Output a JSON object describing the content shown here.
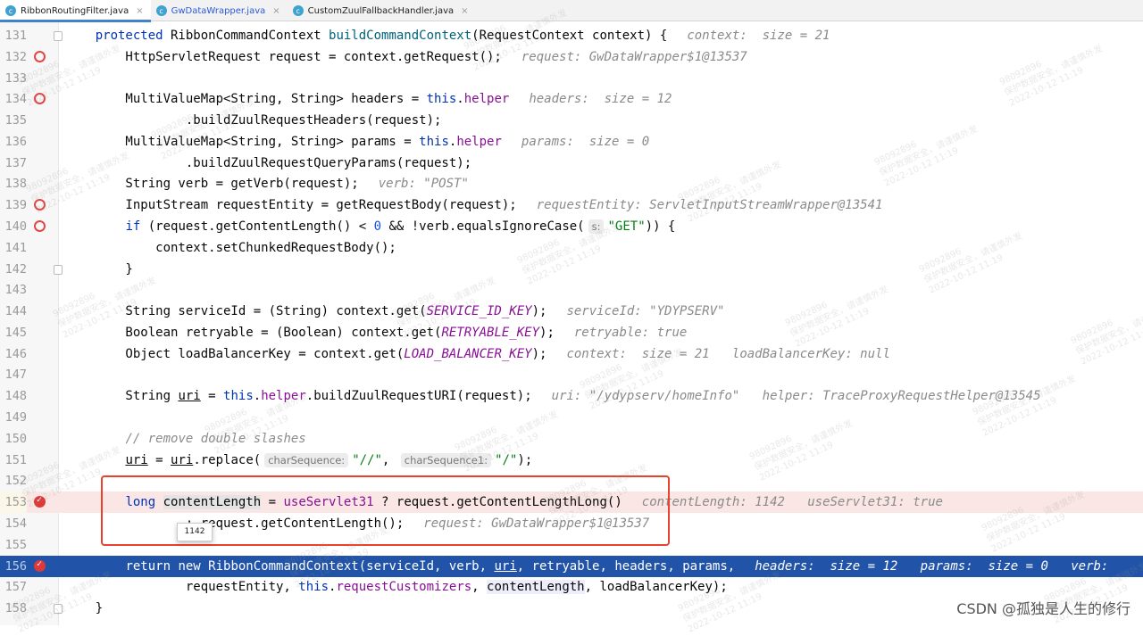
{
  "tabs": [
    {
      "label": "RibbonRoutingFilter.java",
      "active": true,
      "icon": "java-class-icon"
    },
    {
      "label": "GwDataWrapper.java",
      "modified": true,
      "icon": "java-class-icon"
    },
    {
      "label": "CustomZuulFallbackHandler.java",
      "icon": "java-class-icon"
    }
  ],
  "colors": {
    "breakpoint": "#dc3a3a",
    "execution_line": "#2154a8",
    "annotation_box": "#e8412e"
  },
  "editor": {
    "lines": [
      {
        "n": "131",
        "fold": true,
        "tokens": [
          {
            "c": "",
            "t": "    "
          },
          {
            "c": "kw",
            "t": "protected"
          },
          {
            "c": "",
            "t": " RibbonCommandContext "
          },
          {
            "c": "fn",
            "t": "buildCommandContext"
          },
          {
            "c": "",
            "t": "(RequestContext context) {"
          },
          {
            "c": "hint",
            "t": "context:  size = 21"
          }
        ]
      },
      {
        "n": "132",
        "bp": "hollow",
        "tokens": [
          {
            "c": "",
            "t": "        HttpServletRequest request = context.getRequest();"
          },
          {
            "c": "hint",
            "t": "request: GwDataWrapper$1@13537"
          }
        ]
      },
      {
        "n": "133",
        "tokens": []
      },
      {
        "n": "134",
        "bp": "hollow",
        "tokens": [
          {
            "c": "",
            "t": "        MultiValueMap<String, String> headers = "
          },
          {
            "c": "kw",
            "t": "this"
          },
          {
            "c": "",
            "t": "."
          },
          {
            "c": "fld",
            "t": "helper"
          },
          {
            "c": "hint",
            "t": "headers:  size = 12"
          }
        ]
      },
      {
        "n": "135",
        "tokens": [
          {
            "c": "",
            "t": "                .buildZuulRequestHeaders(request);"
          }
        ]
      },
      {
        "n": "136",
        "tokens": [
          {
            "c": "",
            "t": "        MultiValueMap<String, String> params = "
          },
          {
            "c": "kw",
            "t": "this"
          },
          {
            "c": "",
            "t": "."
          },
          {
            "c": "fld",
            "t": "helper"
          },
          {
            "c": "hint",
            "t": "params:  size = 0"
          }
        ]
      },
      {
        "n": "137",
        "tokens": [
          {
            "c": "",
            "t": "                .buildZuulRequestQueryParams(request);"
          }
        ]
      },
      {
        "n": "138",
        "tokens": [
          {
            "c": "",
            "t": "        String verb = getVerb(request);"
          },
          {
            "c": "hint",
            "t": "verb: \"POST\""
          }
        ]
      },
      {
        "n": "139",
        "bp": "hollow",
        "tokens": [
          {
            "c": "",
            "t": "        InputStream requestEntity = getRequestBody(request);"
          },
          {
            "c": "hint",
            "t": "requestEntity: ServletInputStreamWrapper@13541"
          }
        ]
      },
      {
        "n": "140",
        "bp": "hollow",
        "tokens": [
          {
            "c": "",
            "t": "        "
          },
          {
            "c": "kw",
            "t": "if"
          },
          {
            "c": "",
            "t": " (request.getContentLength() < "
          },
          {
            "c": "num",
            "t": "0"
          },
          {
            "c": "",
            "t": " && !verb.equalsIgnoreCase("
          },
          {
            "c": "ph",
            "t": "s:"
          },
          {
            "c": "str",
            "t": "\"GET\""
          },
          {
            "c": "",
            "t": ")) {"
          }
        ]
      },
      {
        "n": "141",
        "tokens": [
          {
            "c": "",
            "t": "            context.setChunkedRequestBody();"
          }
        ]
      },
      {
        "n": "142",
        "fold": true,
        "tokens": [
          {
            "c": "",
            "t": "        }"
          }
        ]
      },
      {
        "n": "143",
        "tokens": []
      },
      {
        "n": "144",
        "tokens": [
          {
            "c": "",
            "t": "        String serviceId = (String) context.get("
          },
          {
            "c": "cst",
            "t": "SERVICE_ID_KEY"
          },
          {
            "c": "",
            "t": ");"
          },
          {
            "c": "hint",
            "t": "serviceId: \"YDYPSERV\""
          }
        ]
      },
      {
        "n": "145",
        "tokens": [
          {
            "c": "",
            "t": "        Boolean retryable = (Boolean) context.get("
          },
          {
            "c": "cst",
            "t": "RETRYABLE_KEY"
          },
          {
            "c": "",
            "t": ");"
          },
          {
            "c": "hint",
            "t": "retryable: true"
          }
        ]
      },
      {
        "n": "146",
        "tokens": [
          {
            "c": "",
            "t": "        Object loadBalancerKey = context.get("
          },
          {
            "c": "cst",
            "t": "LOAD_BALANCER_KEY"
          },
          {
            "c": "",
            "t": ");"
          },
          {
            "c": "hint",
            "t": "context:  size = 21   loadBalancerKey: null"
          }
        ]
      },
      {
        "n": "147",
        "tokens": []
      },
      {
        "n": "148",
        "tokens": [
          {
            "c": "",
            "t": "        String "
          },
          {
            "c": "ul",
            "t": "uri"
          },
          {
            "c": "",
            "t": " = "
          },
          {
            "c": "kw",
            "t": "this"
          },
          {
            "c": "",
            "t": "."
          },
          {
            "c": "fld",
            "t": "helper"
          },
          {
            "c": "",
            "t": ".buildZuulRequestURI(request);"
          },
          {
            "c": "hint",
            "t": "uri: \"/ydypserv/homeInfo\"   helper: TraceProxyRequestHelper@13545"
          }
        ]
      },
      {
        "n": "149",
        "tokens": []
      },
      {
        "n": "150",
        "tokens": [
          {
            "c": "",
            "t": "        "
          },
          {
            "c": "cmt",
            "t": "// remove double slashes"
          }
        ]
      },
      {
        "n": "151",
        "tokens": [
          {
            "c": "",
            "t": "        "
          },
          {
            "c": "ul",
            "t": "uri"
          },
          {
            "c": "",
            "t": " = "
          },
          {
            "c": "ul",
            "t": "uri"
          },
          {
            "c": "",
            "t": ".replace("
          },
          {
            "c": "ph",
            "t": "charSequence:"
          },
          {
            "c": "str",
            "t": "\"//\""
          },
          {
            "c": "",
            "t": ", "
          },
          {
            "c": "ph",
            "t": "charSequence1:"
          },
          {
            "c": "str",
            "t": "\"/\""
          },
          {
            "c": "",
            "t": ");"
          }
        ]
      },
      {
        "n": "152",
        "tokens": []
      },
      {
        "n": "153",
        "bp": "hit",
        "state": "bp-hit",
        "tokens": [
          {
            "c": "",
            "t": "        "
          },
          {
            "c": "kw",
            "t": "long"
          },
          {
            "c": "",
            "t": " "
          },
          {
            "c": "hl1",
            "t": "contentLength"
          },
          {
            "c": "",
            "t": " = "
          },
          {
            "c": "fld",
            "t": "useServlet31"
          },
          {
            "c": "",
            "t": " ? request.getContentLengthLong()"
          },
          {
            "c": "hint",
            "t": "contentLength: 1142   useServlet31: true"
          }
        ]
      },
      {
        "n": "154",
        "tokens": [
          {
            "c": "",
            "t": "                : request.getContentLength();"
          },
          {
            "c": "hint",
            "t": "request: GwDataWrapper$1@13537"
          }
        ]
      },
      {
        "n": "155",
        "tokens": []
      },
      {
        "n": "156",
        "bp": "hit",
        "state": "sel",
        "tokens": [
          {
            "c": "",
            "t": "        "
          },
          {
            "c": "kw",
            "t": "return new"
          },
          {
            "c": "",
            "t": " RibbonCommandContext(serviceId, verb, "
          },
          {
            "c": "ul",
            "t": "uri"
          },
          {
            "c": "",
            "t": ", retryable, headers, params,"
          },
          {
            "c": "hint",
            "t": "headers:  size = 12   params:  size = 0   verb: "
          }
        ]
      },
      {
        "n": "157",
        "tokens": [
          {
            "c": "",
            "t": "                requestEntity, "
          },
          {
            "c": "kw",
            "t": "this"
          },
          {
            "c": "",
            "t": "."
          },
          {
            "c": "fld",
            "t": "requestCustomizers"
          },
          {
            "c": "",
            "t": ", "
          },
          {
            "c": "hl2",
            "t": "contentLength"
          },
          {
            "c": "",
            "t": ", loadBalancerKey);"
          }
        ]
      },
      {
        "n": "158",
        "fold": true,
        "tokens": [
          {
            "c": "",
            "t": "    }"
          }
        ]
      }
    ]
  },
  "tooltip": {
    "value": "1142"
  },
  "watermark": {
    "id": "98092896",
    "text": "保护数据安全，请谨慎外发",
    "date": "2022-10-12 11:19"
  },
  "csdn": "CSDN @孤独是人生的修行"
}
